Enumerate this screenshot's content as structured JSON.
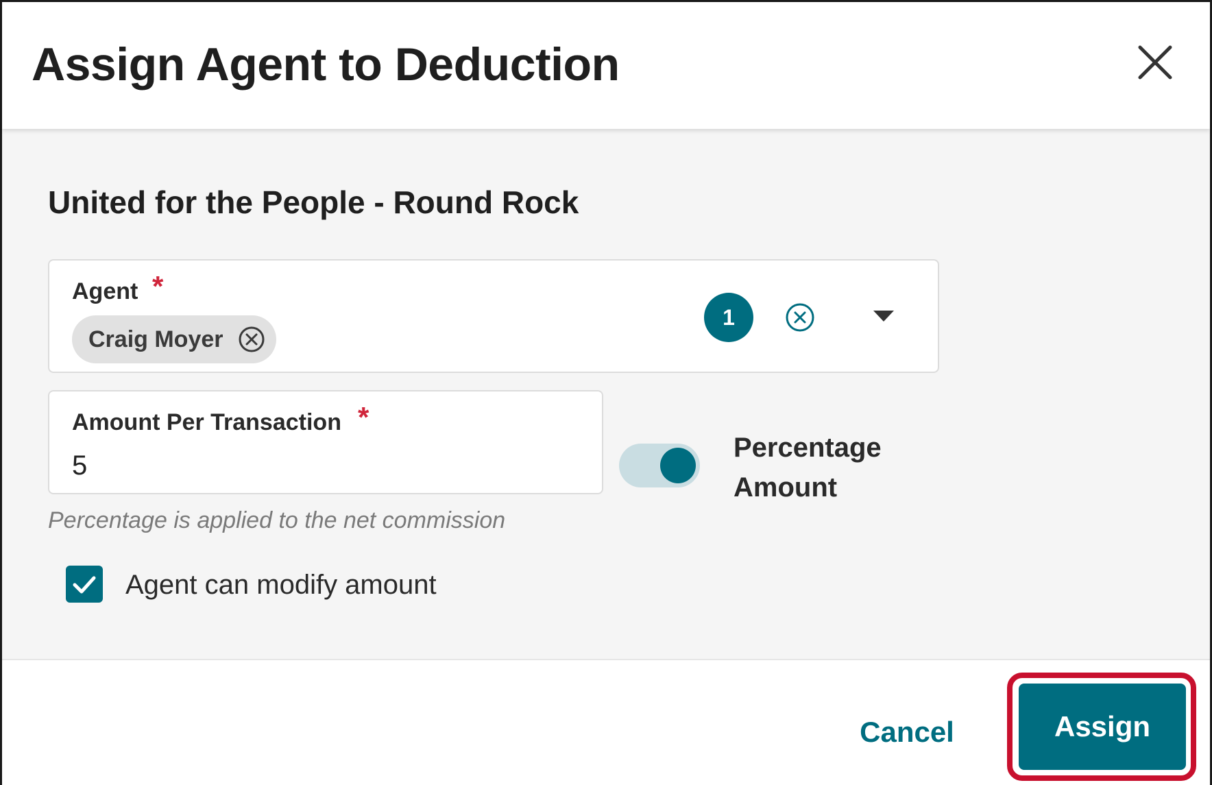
{
  "dialog": {
    "title": "Assign Agent to Deduction",
    "close_icon": "close-icon"
  },
  "body": {
    "org_name": "United for the People - Round Rock",
    "agent_field": {
      "label": "Agent",
      "required_mark": "*",
      "selected": [
        {
          "label": "Craig Moyer",
          "remove_icon": "circle-x-icon"
        }
      ],
      "count": "1",
      "clear_icon": "circle-x-icon",
      "dropdown_icon": "caret-down-icon"
    },
    "amount_field": {
      "label": "Amount Per Transaction",
      "required_mark": "*",
      "value": "5"
    },
    "toggle": {
      "label": "Percentage Amount",
      "state": "on"
    },
    "hint": "Percentage is applied to the net commission",
    "checkbox": {
      "label": "Agent can modify amount",
      "checked": true
    }
  },
  "footer": {
    "cancel_label": "Cancel",
    "assign_label": "Assign"
  },
  "colors": {
    "accent": "#006d80",
    "required": "#d0253b",
    "highlight": "#c8102e",
    "toggle_track": "#c9dde2",
    "body_bg": "#f5f5f5"
  }
}
